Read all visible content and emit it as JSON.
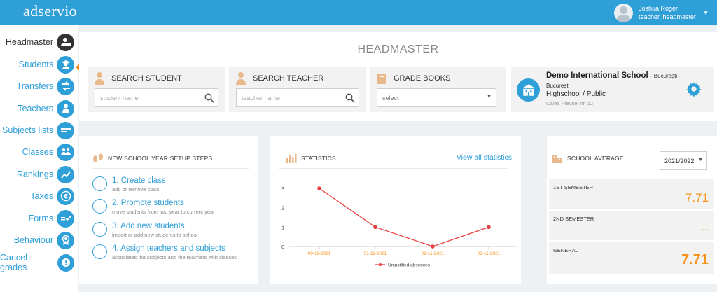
{
  "app": {
    "logo": "adservio"
  },
  "user": {
    "name": "Joshua Roger",
    "role": "teacher, headmaster"
  },
  "sidebar": {
    "items": [
      {
        "label": "Headmaster",
        "icon": "headmaster-icon"
      },
      {
        "label": "Students",
        "icon": "student-icon"
      },
      {
        "label": "Transfers",
        "icon": "transfer-arrows-icon"
      },
      {
        "label": "Teachers",
        "icon": "teacher-icon"
      },
      {
        "label": "Subjects lists",
        "icon": "list-bar-icon"
      },
      {
        "label": "Classes",
        "icon": "classes-icon"
      },
      {
        "label": "Rankings",
        "icon": "trend-icon"
      },
      {
        "label": "Taxes",
        "icon": "euro-icon"
      },
      {
        "label": "Forms",
        "icon": "forms-icon"
      },
      {
        "label": "Behaviour",
        "icon": "medal-icon"
      },
      {
        "label": "Cancel grades",
        "icon": "cancel-grades-icon"
      }
    ]
  },
  "header": {
    "title": "HEADMASTER"
  },
  "search_student": {
    "label": "SEARCH STUDENT",
    "placeholder": "student name"
  },
  "search_teacher": {
    "label": "SEARCH TEACHER",
    "placeholder": "teacher name"
  },
  "grade_books": {
    "label": "GRADE BOOKS",
    "selected": "select"
  },
  "school": {
    "name": "Demo International School",
    "city": "- București -",
    "city2": "București",
    "type": "Highschool / Public",
    "address": "Calea Plevnei nr. 12"
  },
  "setup": {
    "title": "NEW SCHOOL YEAR SETUP STEPS",
    "steps": [
      {
        "title": "1. Create class",
        "sub": "add or remove class"
      },
      {
        "title": "2. Promote students",
        "sub": "move students from last year to current year"
      },
      {
        "title": "3. Add new students",
        "sub": "import or add new students to school"
      },
      {
        "title": "4. Assign teachers and subjects",
        "sub": "associates the subjects and the teachers with classes"
      }
    ]
  },
  "statistics": {
    "title": "STATISTICS",
    "view_all": "View all statistics"
  },
  "chart_data": {
    "type": "line",
    "x": [
      "09-11-2021",
      "01-11-2021",
      "02-11-2021",
      "03-11-2021"
    ],
    "series": [
      {
        "name": "Unjustified absences",
        "values": [
          3,
          1,
          0,
          1
        ]
      }
    ],
    "yticks": [
      0,
      1,
      2,
      3
    ],
    "ylim": [
      0,
      3
    ],
    "color": "#e84040",
    "legend": "bottom"
  },
  "school_average": {
    "title": "SCHOOL AVERAGE",
    "year": "2021/2022",
    "rows": [
      {
        "label": "1ST SEMESTER",
        "value": "7.71"
      },
      {
        "label": "2ND SEMESTER",
        "value": "--"
      },
      {
        "label": "GENERAL",
        "value": "7.71"
      }
    ]
  },
  "colors": {
    "brand": "#2f9fd8",
    "accent": "#f7941d",
    "arrow": "#f7821b"
  }
}
